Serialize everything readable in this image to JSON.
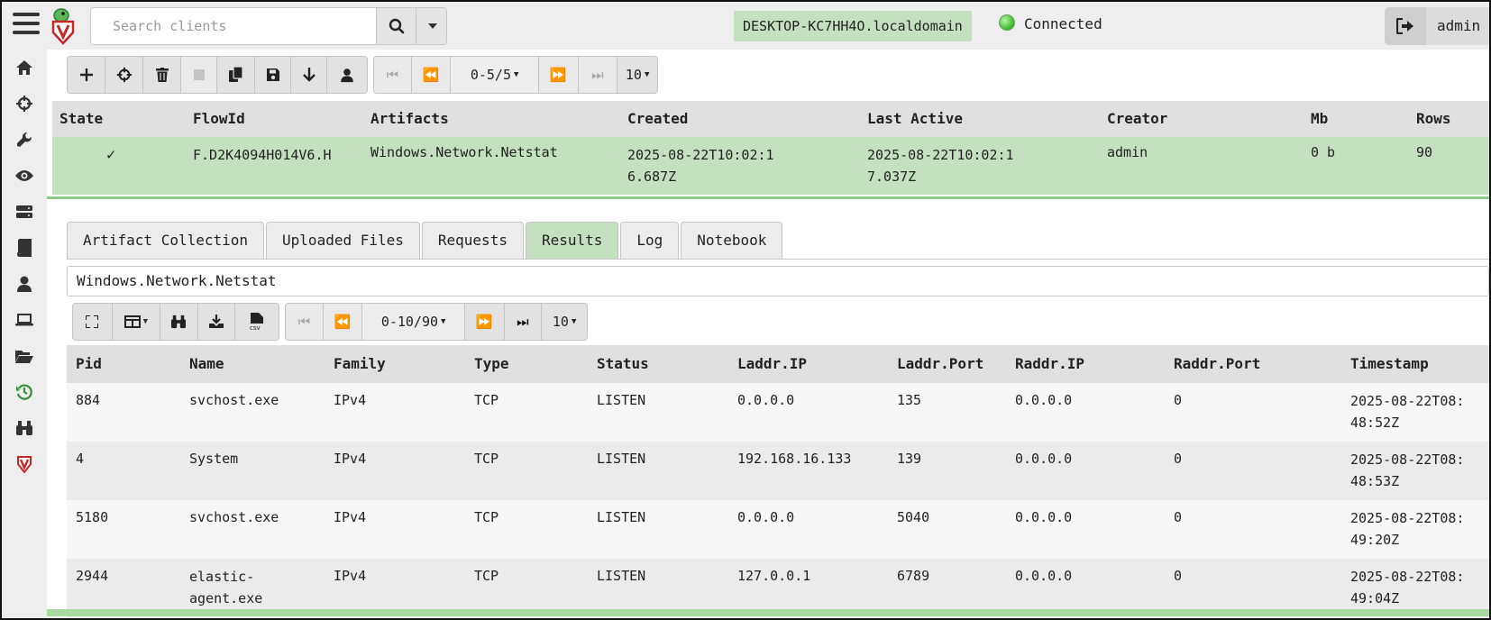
{
  "topbar": {
    "search_placeholder": "Search clients",
    "hostname": "DESKTOP-KC7HH4O.localdomain",
    "connection_status": "Connected",
    "username": "admin"
  },
  "sidebar": {
    "items": [
      {
        "icon": "home-icon"
      },
      {
        "icon": "crosshairs-icon"
      },
      {
        "icon": "wrench-icon"
      },
      {
        "icon": "eye-icon"
      },
      {
        "icon": "server-icon"
      },
      {
        "icon": "book-icon"
      },
      {
        "icon": "user-icon"
      },
      {
        "icon": "laptop-icon"
      },
      {
        "icon": "folder-open-icon"
      },
      {
        "icon": "history-icon",
        "active": true
      },
      {
        "icon": "binoculars-icon"
      },
      {
        "icon": "velociraptor-icon"
      }
    ]
  },
  "flows_toolbar": {
    "page_range": "0-5/5",
    "page_size": "10"
  },
  "flows_table": {
    "columns": [
      "State",
      "FlowId",
      "Artifacts",
      "Created",
      "Last Active",
      "Creator",
      "Mb",
      "Rows"
    ],
    "rows": [
      {
        "state": "✓",
        "flow_id": "F.D2K4094H014V6.H",
        "artifacts": "Windows.Network.Netstat",
        "created": "2025-08-22T10:02:16.687Z",
        "last_active": "2025-08-22T10:02:17.037Z",
        "creator": "admin",
        "mb": "0 b",
        "rows": "90"
      }
    ]
  },
  "tabs": [
    {
      "label": "Artifact Collection"
    },
    {
      "label": "Uploaded Files"
    },
    {
      "label": "Requests"
    },
    {
      "label": "Results",
      "active": true
    },
    {
      "label": "Log"
    },
    {
      "label": "Notebook"
    }
  ],
  "results": {
    "artifact_name": "Windows.Network.Netstat",
    "page_range": "0-10/90",
    "page_size": "10",
    "columns": [
      "Pid",
      "Name",
      "Family",
      "Type",
      "Status",
      "Laddr.IP",
      "Laddr.Port",
      "Raddr.IP",
      "Raddr.Port",
      "Timestamp"
    ],
    "rows": [
      {
        "pid": "884",
        "name": "svchost.exe",
        "family": "IPv4",
        "type": "TCP",
        "status": "LISTEN",
        "laddr_ip": "0.0.0.0",
        "laddr_port": "135",
        "raddr_ip": "0.0.0.0",
        "raddr_port": "0",
        "timestamp": "2025-08-22T08:48:52Z"
      },
      {
        "pid": "4",
        "name": "System",
        "family": "IPv4",
        "type": "TCP",
        "status": "LISTEN",
        "laddr_ip": "192.168.16.133",
        "laddr_port": "139",
        "raddr_ip": "0.0.0.0",
        "raddr_port": "0",
        "timestamp": "2025-08-22T08:48:53Z"
      },
      {
        "pid": "5180",
        "name": "svchost.exe",
        "family": "IPv4",
        "type": "TCP",
        "status": "LISTEN",
        "laddr_ip": "0.0.0.0",
        "laddr_port": "5040",
        "raddr_ip": "0.0.0.0",
        "raddr_port": "0",
        "timestamp": "2025-08-22T08:49:20Z"
      },
      {
        "pid": "2944",
        "name": "elastic-agent.exe",
        "family": "IPv4",
        "type": "TCP",
        "status": "LISTEN",
        "laddr_ip": "127.0.0.1",
        "laddr_port": "6789",
        "raddr_ip": "0.0.0.0",
        "raddr_port": "0",
        "timestamp": "2025-08-22T08:49:04Z"
      }
    ]
  },
  "colors": {
    "success_green": "#c5e0c0",
    "header_gray": "#e0e0e0",
    "sidebar_bg": "#eeeeee",
    "active_icon": "#3a8f3a",
    "brand_red": "#c62828"
  }
}
